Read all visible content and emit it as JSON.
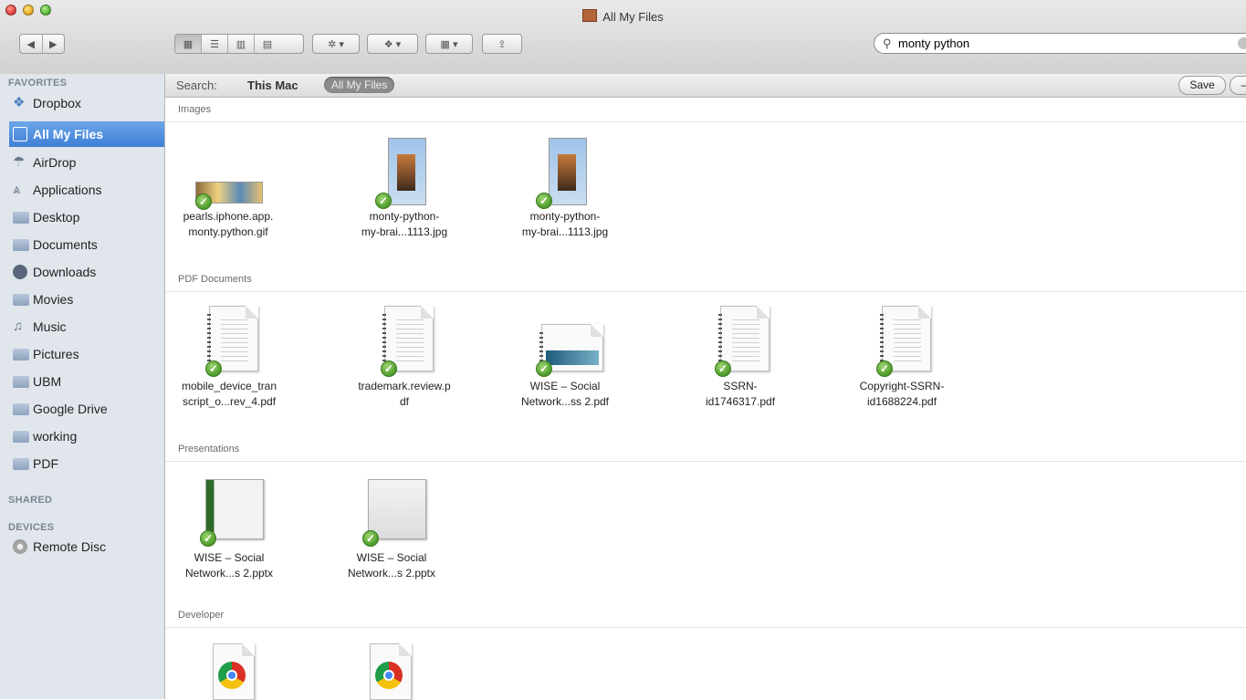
{
  "window": {
    "title": "All My Files"
  },
  "search": {
    "query": "monty python"
  },
  "scope": {
    "label": "Search:",
    "this_mac": "This Mac",
    "all_my_files": "All My Files",
    "save": "Save",
    "minus": "–"
  },
  "sidebar": {
    "favorites_header": "FAVORITES",
    "favorites": [
      {
        "label": "Dropbox",
        "icon": "dropbox-icon"
      },
      {
        "label": "All My Files",
        "icon": "all-my-files-icon",
        "selected": true
      },
      {
        "label": "AirDrop",
        "icon": "airdrop-icon"
      },
      {
        "label": "Applications",
        "icon": "applications-icon"
      },
      {
        "label": "Desktop",
        "icon": "desktop-icon"
      },
      {
        "label": "Documents",
        "icon": "documents-icon"
      },
      {
        "label": "Downloads",
        "icon": "downloads-icon"
      },
      {
        "label": "Movies",
        "icon": "movies-icon"
      },
      {
        "label": "Music",
        "icon": "music-icon"
      },
      {
        "label": "Pictures",
        "icon": "pictures-icon"
      },
      {
        "label": "UBM",
        "icon": "folder-icon"
      },
      {
        "label": "Google Drive",
        "icon": "folder-icon"
      },
      {
        "label": "working",
        "icon": "folder-icon"
      },
      {
        "label": "PDF",
        "icon": "folder-icon"
      }
    ],
    "shared_header": "SHARED",
    "devices_header": "DEVICES",
    "devices": [
      {
        "label": "Remote Disc",
        "icon": "remote-disc-icon"
      }
    ]
  },
  "groups": [
    {
      "title": "Images",
      "items": [
        {
          "line1": "pearls.iphone.app.",
          "line2": "monty.python.gif"
        },
        {
          "line1": "monty-python-",
          "line2": "my-brai...1113.jpg"
        },
        {
          "line1": "monty-python-",
          "line2": "my-brai...1113.jpg"
        }
      ]
    },
    {
      "title": "PDF Documents",
      "items": [
        {
          "line1": "mobile_device_tran",
          "line2": "script_o...rev_4.pdf"
        },
        {
          "line1": "trademark.review.p",
          "line2": "df"
        },
        {
          "line1": "WISE – Social",
          "line2": "Network...ss 2.pdf"
        },
        {
          "line1": "SSRN-",
          "line2": "id1746317.pdf"
        },
        {
          "line1": "Copyright-SSRN-",
          "line2": "id1688224.pdf"
        }
      ]
    },
    {
      "title": "Presentations",
      "items": [
        {
          "line1": "WISE – Social",
          "line2": "Network...s 2.pptx"
        },
        {
          "line1": "WISE – Social",
          "line2": "Network...s 2.pptx"
        }
      ]
    },
    {
      "title": "Developer",
      "items": []
    }
  ]
}
